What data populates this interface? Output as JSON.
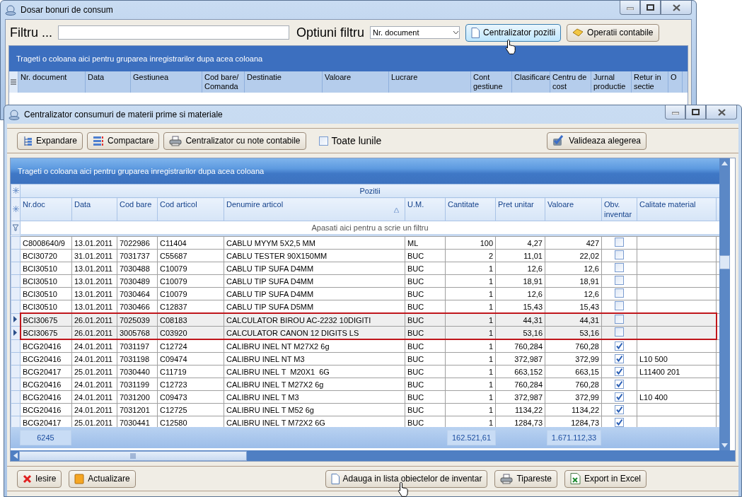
{
  "back_window": {
    "title": "Dosar bonuri de consum",
    "filter_label": "Filtru ...",
    "options_label": "Optiuni filtru",
    "options_select": {
      "value": "Nr. document"
    },
    "buttons": [
      {
        "label": "Centralizator pozitii",
        "hovered": true
      },
      {
        "label": "Operatii contabile",
        "hovered": false
      }
    ],
    "group_hint": "Trageti o coloana aici pentru gruparea inregistrarilor dupa acea coloana",
    "columns": [
      "Nr. document",
      "Data",
      "Gestiunea",
      "Cod bare/ Comanda",
      "Destinatie",
      "Valoare",
      "Lucrare",
      "Cont gestiune",
      "Clasificare",
      "Centru de cost",
      "Jurnal productie",
      "Retur in sectie",
      "O"
    ]
  },
  "front_window": {
    "title": "Centralizator consumuri de materii prime si materiale",
    "toolbar": {
      "buttons": [
        "Expandare",
        "Compactare",
        "Centralizator cu note contabile"
      ],
      "checkbox": {
        "label": "Toate lunile",
        "checked": false
      },
      "validate_button": "Valideaza alegerea"
    },
    "grid": {
      "group_hint": "Trageti o coloana aici pentru gruparea inregistrarilor dupa acea coloana",
      "band_title": "Pozitii",
      "columns": [
        {
          "label": "Nr.doc",
          "sorted": false
        },
        {
          "label": "Data",
          "sorted": false
        },
        {
          "label": "Cod bare",
          "sorted": false
        },
        {
          "label": "Cod articol",
          "sorted": false
        },
        {
          "label": "Denumire articol",
          "sorted": true
        },
        {
          "label": "U.M.",
          "sorted": false
        },
        {
          "label": "Cantitate",
          "sorted": false
        },
        {
          "label": "Pret unitar",
          "sorted": false
        },
        {
          "label": "Valoare",
          "sorted": false
        },
        {
          "label": "Obv. inventar",
          "sorted": false
        },
        {
          "label": "Calitate material",
          "sorted": false
        }
      ],
      "filter_hint": "Apasati aici pentru a scrie un filtru",
      "rows": [
        {
          "nr_doc": "C8008640/9",
          "data": "13.01.2011",
          "cod_bare": "7022986",
          "cod_articol": "C11404",
          "denumire": "CABLU MYYM 5X2,5 MM",
          "um": "ML",
          "cantitate": "100",
          "pret_unitar": "4,27",
          "valoare": "427",
          "obv_inventar": false,
          "selected": false
        },
        {
          "nr_doc": "BCI30720",
          "data": "31.01.2011",
          "cod_bare": "7031737",
          "cod_articol": "C55687",
          "denumire": "CABLU TESTER 90X150MM",
          "um": "BUC",
          "cantitate": "2",
          "pret_unitar": "11,01",
          "valoare": "22,02",
          "obv_inventar": false,
          "selected": false
        },
        {
          "nr_doc": "BCI30510",
          "data": "13.01.2011",
          "cod_bare": "7030488",
          "cod_articol": "C10079",
          "denumire": "CABLU TIP SUFA D4MM",
          "um": "BUC",
          "cantitate": "1",
          "pret_unitar": "12,6",
          "valoare": "12,6",
          "obv_inventar": false,
          "selected": false
        },
        {
          "nr_doc": "BCI30510",
          "data": "13.01.2011",
          "cod_bare": "7030489",
          "cod_articol": "C10079",
          "denumire": "CABLU TIP SUFA D4MM",
          "um": "BUC",
          "cantitate": "1",
          "pret_unitar": "18,91",
          "valoare": "18,91",
          "obv_inventar": false,
          "selected": false
        },
        {
          "nr_doc": "BCI30510",
          "data": "13.01.2011",
          "cod_bare": "7030464",
          "cod_articol": "C10079",
          "denumire": "CABLU TIP SUFA D4MM",
          "um": "BUC",
          "cantitate": "1",
          "pret_unitar": "12,6",
          "valoare": "12,6",
          "obv_inventar": false,
          "selected": false
        },
        {
          "nr_doc": "BCI30510",
          "data": "13.01.2011",
          "cod_bare": "7030466",
          "cod_articol": "C12837",
          "denumire": "CABLU TIP SUFA D5MM",
          "um": "BUC",
          "cantitate": "1",
          "pret_unitar": "15,43",
          "valoare": "15,43",
          "obv_inventar": false,
          "selected": false
        },
        {
          "nr_doc": "BCI30675",
          "data": "26.01.2011",
          "cod_bare": "7025039",
          "cod_articol": "C08183",
          "denumire": "CALCULATOR BIROU AC-2232 10DIGITI",
          "um": "BUC",
          "cantitate": "1",
          "pret_unitar": "44,31",
          "valoare": "44,31",
          "obv_inventar": false,
          "selected": true
        },
        {
          "nr_doc": "BCI30675",
          "data": "26.01.2011",
          "cod_bare": "3005768",
          "cod_articol": "C03920",
          "denumire": "CALCULATOR CANON 12 DIGITS LS",
          "um": "BUC",
          "cantitate": "1",
          "pret_unitar": "53,16",
          "valoare": "53,16",
          "obv_inventar": false,
          "selected": true
        },
        {
          "nr_doc": "BCG20416",
          "data": "24.01.2011",
          "cod_bare": "7031197",
          "cod_articol": "C12724",
          "denumire": "CALIBRU INEL NT M27X2 6g",
          "um": "BUC",
          "cantitate": "1",
          "pret_unitar": "760,284",
          "valoare": "760,28",
          "obv_inventar": true,
          "selected": false
        },
        {
          "nr_doc": "BCG20416",
          "data": "24.01.2011",
          "cod_bare": "7031198",
          "cod_articol": "C09474",
          "denumire": "CALIBRU INEL NT M3",
          "um": "BUC",
          "cantitate": "1",
          "pret_unitar": "372,987",
          "valoare": "372,99",
          "obv_inventar": true,
          "calitate_material": "L10 500",
          "selected": false
        },
        {
          "nr_doc": "BCG20417",
          "data": "25.01.2011",
          "cod_bare": "7030440",
          "cod_articol": "C11719",
          "denumire": "CALIBRU INEL T  M20X1  6G",
          "um": "BUC",
          "cantitate": "1",
          "pret_unitar": "663,152",
          "valoare": "663,15",
          "obv_inventar": true,
          "calitate_material": "L11400 201",
          "selected": false
        },
        {
          "nr_doc": "BCG20416",
          "data": "24.01.2011",
          "cod_bare": "7031199",
          "cod_articol": "C12723",
          "denumire": "CALIBRU INEL T M27X2 6g",
          "um": "BUC",
          "cantitate": "1",
          "pret_unitar": "760,284",
          "valoare": "760,28",
          "obv_inventar": true,
          "selected": false
        },
        {
          "nr_doc": "BCG20416",
          "data": "24.01.2011",
          "cod_bare": "7031200",
          "cod_articol": "C09473",
          "denumire": "CALIBRU INEL T M3",
          "um": "BUC",
          "cantitate": "1",
          "pret_unitar": "372,987",
          "valoare": "372,99",
          "obv_inventar": true,
          "calitate_material": "L10 400",
          "selected": false
        },
        {
          "nr_doc": "BCG20416",
          "data": "24.01.2011",
          "cod_bare": "7031201",
          "cod_articol": "C12725",
          "denumire": "CALIBRU INEL T M52 6g",
          "um": "BUC",
          "cantitate": "1",
          "pret_unitar": "1134,22",
          "valoare": "1134,22",
          "obv_inventar": true,
          "selected": false
        },
        {
          "nr_doc": "BCG20417",
          "data": "25.01.2011",
          "cod_bare": "7030441",
          "cod_articol": "C12580",
          "denumire": "CALIBRU INEL T M72X2 6G",
          "um": "BUC",
          "cantitate": "1",
          "pret_unitar": "1284,73",
          "valoare": "1284,73",
          "obv_inventar": true,
          "selected": false
        }
      ],
      "totals": {
        "count": "6245",
        "cantitate": "162.521,61",
        "valoare": "1.671.112,33"
      }
    },
    "bottom_buttons": [
      "Iesire",
      "Actualizare",
      "Adauga in lista obiectelor de inventar",
      "Tipareste",
      "Export in Excel"
    ]
  }
}
